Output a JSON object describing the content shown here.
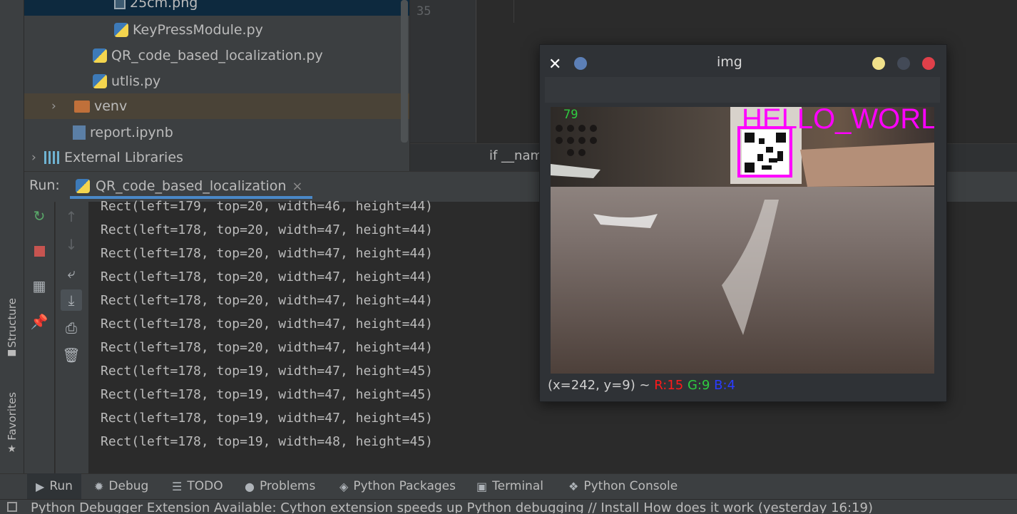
{
  "project_tree": {
    "items": [
      {
        "label": "25cm.png",
        "icon": "png-file-icon"
      },
      {
        "label": "KeyPressModule.py",
        "icon": "python-file-icon"
      },
      {
        "label": "QR_code_based_localization.py",
        "icon": "python-file-icon"
      },
      {
        "label": "utlis.py",
        "icon": "python-file-icon"
      },
      {
        "label": "venv",
        "icon": "folder-icon"
      },
      {
        "label": "report.ipynb",
        "icon": "notebook-file-icon"
      },
      {
        "label": "External Libraries",
        "icon": "library-icon"
      }
    ]
  },
  "editor": {
    "line_number": "35",
    "breadcrumb": "if __nam"
  },
  "side_tabs": {
    "structure": "Structure",
    "favorites": "Favorites"
  },
  "run_panel": {
    "label": "Run:",
    "tab": "QR_code_based_localization",
    "close": "×",
    "console_lines": [
      "Rect(left=179, top=20, width=46, height=44)",
      "Rect(left=178, top=20, width=47, height=44)",
      "Rect(left=178, top=20, width=47, height=44)",
      "Rect(left=178, top=20, width=47, height=44)",
      "Rect(left=178, top=20, width=47, height=44)",
      "Rect(left=178, top=20, width=47, height=44)",
      "Rect(left=178, top=20, width=47, height=44)",
      "Rect(left=178, top=19, width=47, height=45)",
      "Rect(left=178, top=19, width=47, height=45)",
      "Rect(left=178, top=19, width=47, height=45)",
      "Rect(left=178, top=19, width=48, height=45)"
    ]
  },
  "bottom_tabs": [
    {
      "label": "Run",
      "icon": "run-icon"
    },
    {
      "label": "Debug",
      "icon": "bug-icon"
    },
    {
      "label": "TODO",
      "icon": "list-icon"
    },
    {
      "label": "Problems",
      "icon": "problems-icon"
    },
    {
      "label": "Python Packages",
      "icon": "layers-icon"
    },
    {
      "label": "Terminal",
      "icon": "terminal-icon"
    },
    {
      "label": "Python Console",
      "icon": "python-console-icon"
    }
  ],
  "status_bar": {
    "text": "Python Debugger Extension Available: Cython extension speeds up Python debugging // Install   How does it work (yesterday 16:19)"
  },
  "img_window": {
    "title": "img",
    "fps": "79",
    "overlay_text": "HELLO_WORL",
    "status_coords": "(x=242, y=9) ~ ",
    "status_r": "R:15",
    "status_g": "G:9",
    "status_b": "B:4",
    "colors": {
      "r": "#ff1a1a",
      "g": "#2ecc40",
      "b": "#2a3cff",
      "overlay": "#ff00ff"
    }
  }
}
